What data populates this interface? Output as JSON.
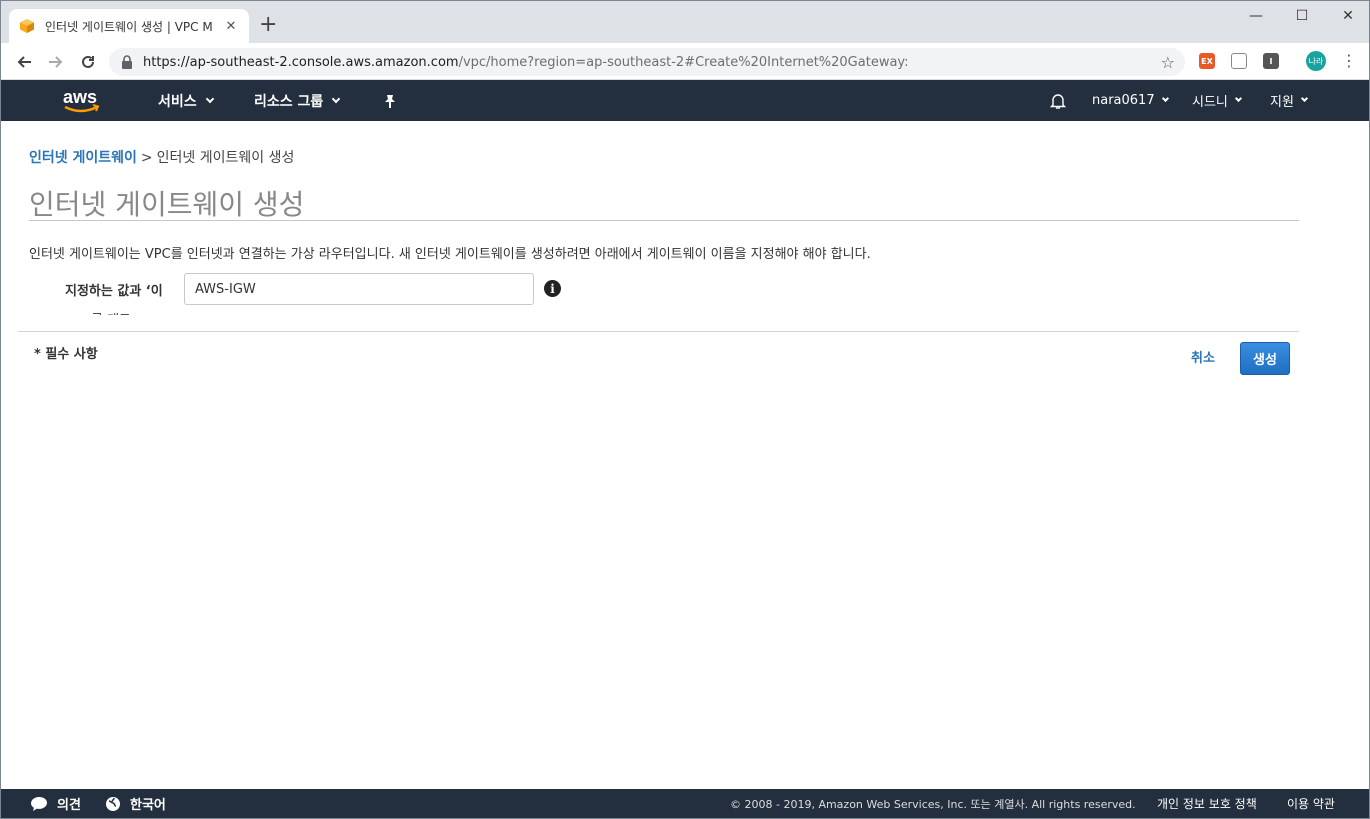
{
  "browser": {
    "tab_title": "인터넷 게이트웨이 생성 | VPC M",
    "tab_close": "✕",
    "new_tab": "+",
    "url_host": "https://ap-southeast-2.console.aws.amazon.com",
    "url_path": "/vpc/home?region=ap-southeast-2#Create%20Internet%20Gateway:",
    "extensions": [
      "EX",
      "I"
    ],
    "profile_label": "나라",
    "window_controls": [
      "—",
      "☐",
      "✕"
    ],
    "menu": "⋮",
    "star": "☆"
  },
  "aws_nav": {
    "logo_text": "aws",
    "services": "서비스",
    "resource_groups": "리소스 그룹",
    "user": "nara0617",
    "region": "시드니",
    "support": "지원"
  },
  "breadcrumb": {
    "parent": "인터넷 게이트웨이",
    "separator": ">",
    "current": "인터넷 게이트웨이 생성"
  },
  "page": {
    "title": "인터넷 게이트웨이 생성",
    "description": "인터넷 게이트웨이는 VPC를 인터넷과 연결하는 가상 라우터입니다. 새 인터넷 게이트웨이를 생성하려면 아래에서 게이트웨이 이름을 지정해야 해야 합니다.",
    "field_label": "지정하는 값과 ‘이",
    "field_value": "AWS-IGW",
    "info_glyph": "i",
    "cut_label": "름 태그",
    "required_note": "* 필수 사항",
    "cancel_label": "취소",
    "create_label": "생성"
  },
  "footer": {
    "feedback": "의견",
    "language": "한국어",
    "copyright": "© 2008 - 2019, Amazon Web Services, Inc. 또는 계열사. All rights reserved.",
    "privacy": "개인 정보 보호 정책",
    "terms": "이용 약관"
  },
  "colors": {
    "aws_nav_bg": "#232f3e",
    "link_blue": "#2a74b8",
    "primary_button": "#1f6fc2",
    "aws_orange": "#ff9900"
  }
}
